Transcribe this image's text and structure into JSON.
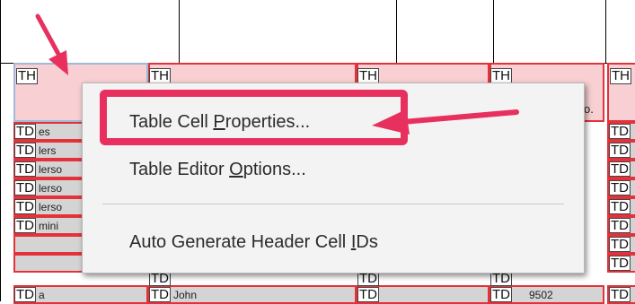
{
  "table": {
    "header_tags": [
      "TH",
      "TH",
      "TH",
      "TH",
      "TH"
    ],
    "header_partial_text": "o.",
    "row_tag": "TD",
    "row_fragments": [
      "es",
      "lers",
      "lerso",
      "lerso",
      "lerso",
      "mini",
      "a"
    ],
    "bottom_row_cells": [
      "John",
      "9502"
    ]
  },
  "context_menu": {
    "items": [
      {
        "label_pre": "Table Cell ",
        "label_key": "P",
        "label_post": "roperties..."
      },
      {
        "label_pre": "Table Editor ",
        "label_key": "O",
        "label_post": "ptions..."
      },
      {
        "label_pre": "Auto Generate Header Cell ",
        "label_key": "I",
        "label_post": "Ds"
      }
    ]
  },
  "annotation": {
    "color": "#e8305f"
  }
}
